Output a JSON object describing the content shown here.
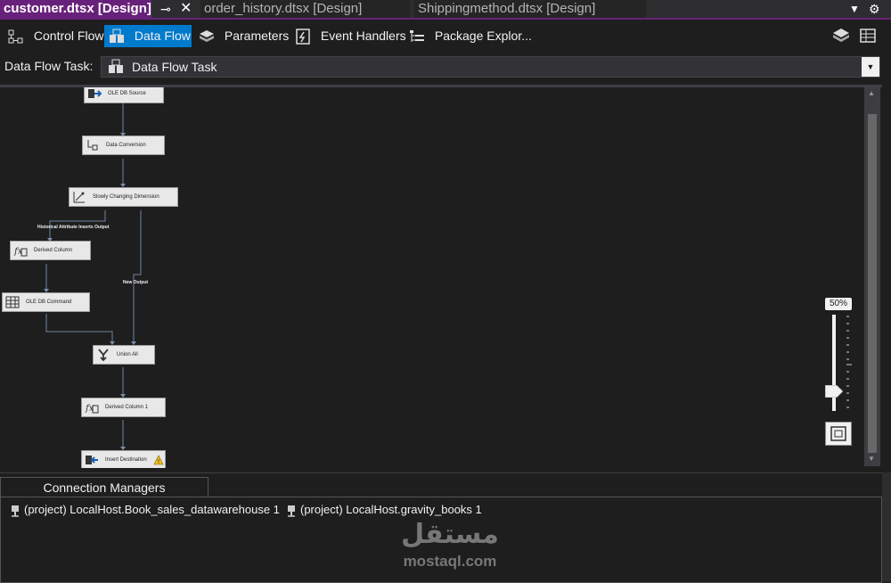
{
  "tabs": [
    {
      "label": "customer.dtsx [Design]",
      "active": true
    },
    {
      "label": "order_history.dtsx [Design]",
      "active": false
    },
    {
      "label": "Shippingmethod.dtsx [Design]",
      "active": false
    }
  ],
  "designer_tabs": [
    {
      "label": "Control Flow",
      "icon": "control-flow-icon",
      "selected": false
    },
    {
      "label": "Data Flow",
      "icon": "data-flow-icon",
      "selected": true
    },
    {
      "label": "Parameters",
      "icon": "parameters-icon",
      "selected": false
    },
    {
      "label": "Event Handlers",
      "icon": "event-handlers-icon",
      "selected": false
    },
    {
      "label": "Package Explor...",
      "icon": "package-explorer-icon",
      "selected": false
    }
  ],
  "task": {
    "label": "Data Flow Task:",
    "value": "Data Flow Task"
  },
  "components": [
    {
      "label": "OLE DB Source",
      "icon": "ole-db-source-icon"
    },
    {
      "label": "Data Conversion",
      "icon": "data-conversion-icon"
    },
    {
      "label": "Slowly Changing Dimension",
      "icon": "slowly-changing-dimension-icon"
    },
    {
      "label": "Derived Column",
      "icon": "derived-column-icon"
    },
    {
      "label": "OLE DB Command",
      "icon": "ole-db-command-icon"
    },
    {
      "label": "Union All",
      "icon": "union-all-icon"
    },
    {
      "label": "Derived Column 1",
      "icon": "derived-column-icon"
    },
    {
      "label": "Insert Destination",
      "icon": "ole-db-destination-icon",
      "warning": true
    }
  ],
  "path_labels": {
    "historical": "Historical Attribute Inserts Output",
    "new_output": "New Output"
  },
  "zoom": {
    "label": "50%"
  },
  "connection_managers": {
    "tab_label": "Connection Managers",
    "items": [
      "(project) LocalHost.Book_sales_datawarehouse 1",
      "(project) LocalHost.gravity_books 1"
    ]
  },
  "watermark": {
    "arabic": "مستقل",
    "latin": "mostaql.com"
  }
}
